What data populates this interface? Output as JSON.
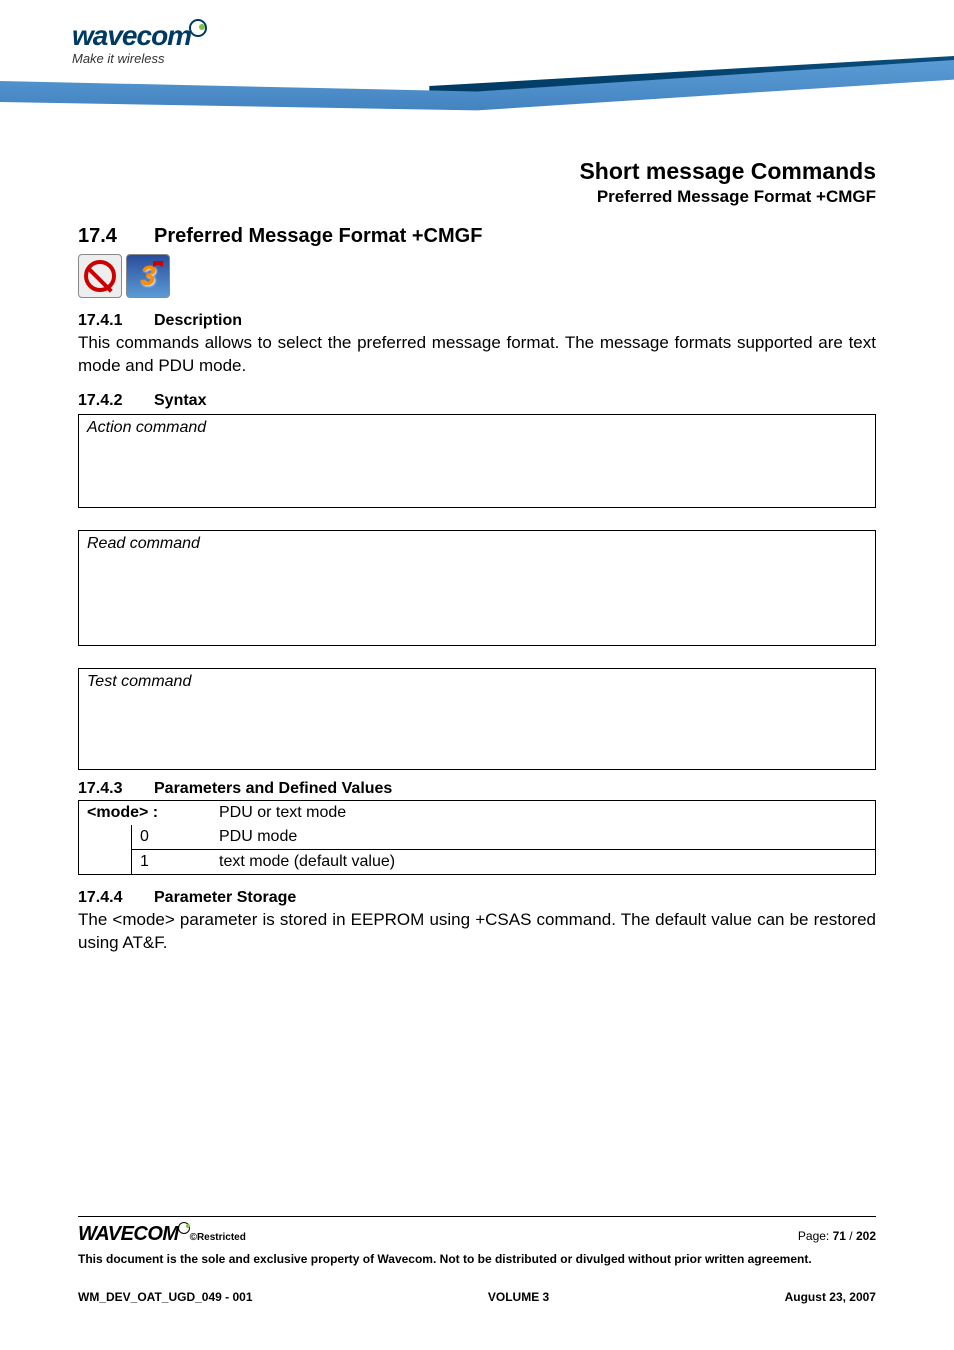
{
  "brand": {
    "name": "wavecom",
    "tagline": "Make it wireless"
  },
  "header": {
    "chapter_title": "Short message Commands",
    "section_title": "Preferred Message Format +CMGF"
  },
  "section": {
    "number": "17.4",
    "title": "Preferred Message Format +CMGF"
  },
  "icons": [
    "prohibit-icon",
    "three-flag-icon"
  ],
  "subs": {
    "desc": {
      "number": "17.4.1",
      "title": "Description",
      "text": "This commands allows to select the preferred message format. The message formats supported are text mode and PDU mode."
    },
    "syntax": {
      "number": "17.4.2",
      "title": "Syntax",
      "boxes": [
        {
          "label": "Action command"
        },
        {
          "label": "Read command"
        },
        {
          "label": "Test command"
        }
      ]
    },
    "params": {
      "number": "17.4.3",
      "title": "Parameters and Defined Values",
      "param_name": "<mode> :",
      "param_desc": "PDU or text mode",
      "rows": [
        {
          "value": "0",
          "desc": "PDU mode"
        },
        {
          "value": "1",
          "desc": "text mode (default value)"
        }
      ]
    },
    "storage": {
      "number": "17.4.4",
      "title": "Parameter Storage",
      "text": "The <mode> parameter is stored in EEPROM using +CSAS command. The default value can be restored using AT&F."
    }
  },
  "footer": {
    "logo": "WAVECOM",
    "restricted": "©Restricted",
    "page_label": "Page: ",
    "page_current": "71",
    "page_sep": " / ",
    "page_total": "202",
    "disclaimer": "This document is the sole and exclusive property of Wavecom. Not to be distributed or divulged without prior written agreement.",
    "doc_id": "WM_DEV_OAT_UGD_049 - 001",
    "volume": "VOLUME 3",
    "date": "August 23, 2007"
  }
}
